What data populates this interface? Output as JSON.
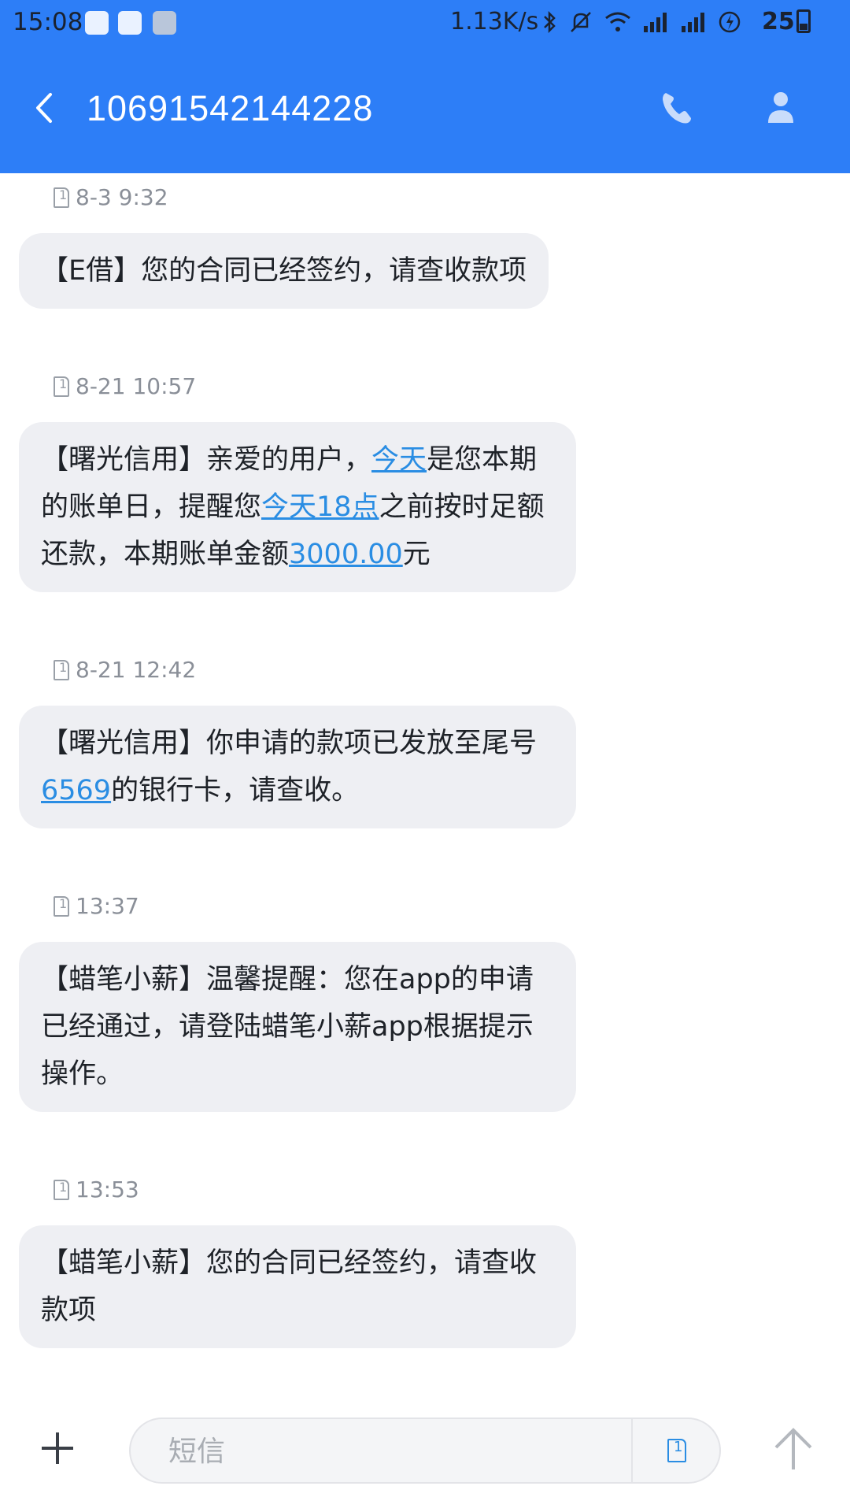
{
  "status_bar": {
    "time": "15:08",
    "network_speed": "1.13K/s",
    "battery": "25",
    "icons": [
      "wechat-icon",
      "keyboard-icon",
      "app-icon",
      "bluetooth-icon",
      "mute-icon",
      "wifi-icon",
      "signal-icon",
      "signal-icon",
      "charging-icon",
      "battery-icon"
    ]
  },
  "header": {
    "title": "10691542144228",
    "accent_color": "#2d7ef7"
  },
  "messages": [
    {
      "time": "8-3 9:32",
      "segments": [
        {
          "text": "【E借】您的合同已经签约，请查收款项",
          "link": false
        }
      ]
    },
    {
      "time": "8-21 10:57",
      "segments": [
        {
          "text": "【曙光信用】亲爱的用户，",
          "link": false
        },
        {
          "text": "今天",
          "link": true
        },
        {
          "text": "是您本期的账单日，提醒您",
          "link": false
        },
        {
          "text": "今天18点",
          "link": true
        },
        {
          "text": "之前按时足额还款，本期账单金额",
          "link": false
        },
        {
          "text": "3000.00",
          "link": true
        },
        {
          "text": "元",
          "link": false
        }
      ]
    },
    {
      "time": "8-21 12:42",
      "segments": [
        {
          "text": "【曙光信用】你申请的款项已发放至尾号",
          "link": false
        },
        {
          "text": "6569",
          "link": true
        },
        {
          "text": "的银行卡，请查收。",
          "link": false
        }
      ]
    },
    {
      "time": "13:37",
      "segments": [
        {
          "text": "【蜡笔小薪】温馨提醒：您在app的申请已经通过，请登陆蜡笔小薪app根据提示操作。",
          "link": false
        }
      ]
    },
    {
      "time": "13:53",
      "segments": [
        {
          "text": "【蜡笔小薪】您的合同已经签约，请查收款项",
          "link": false
        }
      ]
    }
  ],
  "composer": {
    "placeholder": "短信",
    "value": ""
  }
}
